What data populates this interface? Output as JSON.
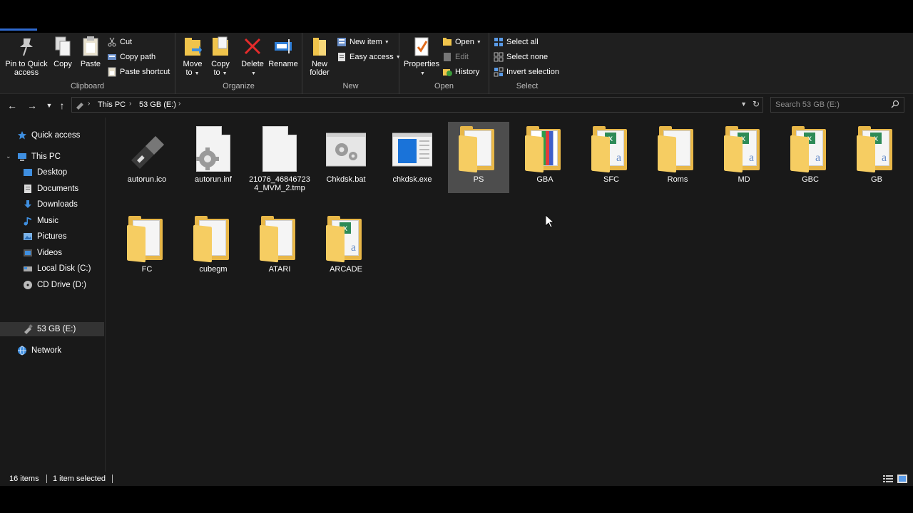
{
  "ribbon": {
    "clipboard": {
      "label": "Clipboard",
      "pin_label_1": "Pin to Quick",
      "pin_label_2": "access",
      "copy_label": "Copy",
      "paste_label": "Paste",
      "cut_label": "Cut",
      "copy_path_label": "Copy path",
      "paste_shortcut_label": "Paste shortcut"
    },
    "organize": {
      "label": "Organize",
      "move_to_1": "Move",
      "move_to_2": "to",
      "copy_to_1": "Copy",
      "copy_to_2": "to",
      "delete_label": "Delete",
      "rename_label": "Rename"
    },
    "new": {
      "label": "New",
      "new_folder_1": "New",
      "new_folder_2": "folder",
      "new_item_label": "New item",
      "easy_access_label": "Easy access"
    },
    "open": {
      "label": "Open",
      "properties_label": "Properties",
      "open_label": "Open",
      "edit_label": "Edit",
      "history_label": "History"
    },
    "select": {
      "label": "Select",
      "select_all_label": "Select all",
      "select_none_label": "Select none",
      "invert_label": "Invert selection"
    }
  },
  "address": {
    "crumbs": [
      "This PC",
      "53 GB (E:)"
    ],
    "search_placeholder": "Search 53 GB (E:)"
  },
  "sidebar": {
    "items": [
      {
        "label": "Quick access"
      },
      {
        "label": "This PC"
      },
      {
        "label": "Desktop"
      },
      {
        "label": "Documents"
      },
      {
        "label": "Downloads"
      },
      {
        "label": "Music"
      },
      {
        "label": "Pictures"
      },
      {
        "label": "Videos"
      },
      {
        "label": "Local Disk (C:)"
      },
      {
        "label": "CD Drive (D:)"
      },
      {
        "label": "53 GB (E:)"
      },
      {
        "label": "Network"
      }
    ]
  },
  "files": [
    {
      "name": "autorun.ico",
      "kind": "usb-drive-icon"
    },
    {
      "name": "autorun.inf",
      "kind": "settings-file-icon"
    },
    {
      "name": "21076_468467234_MVM_2.tmp",
      "kind": "blank-file-icon"
    },
    {
      "name": "Chkdsk.bat",
      "kind": "batch-file-icon"
    },
    {
      "name": "chkdsk.exe",
      "kind": "exe-file-icon"
    },
    {
      "name": "PS",
      "kind": "folder-icon"
    },
    {
      "name": "GBA",
      "kind": "folder-icon"
    },
    {
      "name": "SFC",
      "kind": "folder-icon"
    },
    {
      "name": "Roms",
      "kind": "folder-icon"
    },
    {
      "name": "MD",
      "kind": "folder-icon"
    },
    {
      "name": "GBC",
      "kind": "folder-icon"
    },
    {
      "name": "GB",
      "kind": "folder-icon"
    },
    {
      "name": "FC",
      "kind": "folder-icon"
    },
    {
      "name": "cubegm",
      "kind": "folder-icon"
    },
    {
      "name": "ATARI",
      "kind": "folder-icon"
    },
    {
      "name": "ARCADE",
      "kind": "folder-icon"
    }
  ],
  "status": {
    "item_count": "16 items",
    "selected": "1 item selected"
  },
  "colors": {
    "accent": "#2f6ad0",
    "folder": "#e8b748",
    "background": "#191919",
    "selection": "#4d4d4d"
  }
}
